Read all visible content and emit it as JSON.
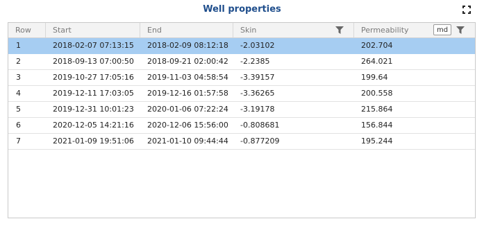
{
  "title": "Well properties",
  "header": {
    "columns": [
      "Row",
      "Start",
      "End",
      "Skin",
      "Permeability"
    ],
    "unit_label": "md"
  },
  "rows": [
    {
      "row": "1",
      "start": "2018-02-07 07:13:15",
      "end": "2018-02-09 08:12:18",
      "skin": "-2.03102",
      "perm": "202.704"
    },
    {
      "row": "2",
      "start": "2018-09-13 07:00:50",
      "end": "2018-09-21 02:00:42",
      "skin": "-2.2385",
      "perm": "264.021"
    },
    {
      "row": "3",
      "start": "2019-10-27 17:05:16",
      "end": "2019-11-03 04:58:54",
      "skin": "-3.39157",
      "perm": "199.64"
    },
    {
      "row": "4",
      "start": "2019-12-11 17:03:05",
      "end": "2019-12-16 01:57:58",
      "skin": "-3.36265",
      "perm": "200.558"
    },
    {
      "row": "5",
      "start": "2019-12-31 10:01:23",
      "end": "2020-01-06 07:22:24",
      "skin": "-3.19178",
      "perm": "215.864"
    },
    {
      "row": "6",
      "start": "2020-12-05 14:21:16",
      "end": "2020-12-06 15:56:00",
      "skin": "-0.808681",
      "perm": "156.844"
    },
    {
      "row": "7",
      "start": "2021-01-09 19:51:06",
      "end": "2021-01-10 09:44:44",
      "skin": "-0.877209",
      "perm": "195.244"
    }
  ],
  "selected_row": "1",
  "colors": {
    "title": "#1f4e8c",
    "selected_row": "#a6cdf2",
    "header_bg": "#f3f3f3"
  },
  "icons": {
    "expand": "expand-icon",
    "filter": "filter-icon"
  }
}
